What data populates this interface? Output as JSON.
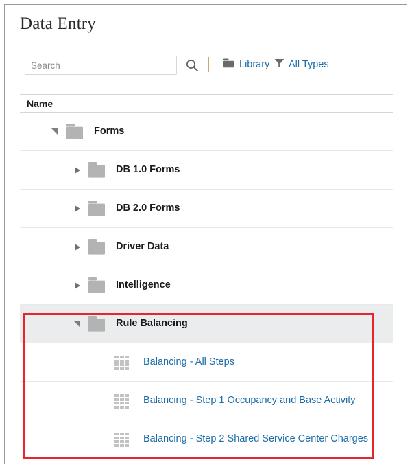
{
  "page": {
    "title": "Data Entry"
  },
  "toolbar": {
    "search_placeholder": "Search",
    "search_value": "",
    "search_icon": "search-icon",
    "library_label": "Library",
    "library_icon": "folder-icon",
    "all_types_label": "All Types",
    "all_types_icon": "filter-funnel-icon"
  },
  "table": {
    "columns": [
      "Name"
    ],
    "rows": [
      {
        "label": "Forms",
        "type": "folder",
        "icon": "folder-icon",
        "state": "expanded",
        "level": 0,
        "selected": false,
        "is_link": false
      },
      {
        "label": "DB 1.0 Forms",
        "type": "folder",
        "icon": "folder-icon",
        "state": "collapsed",
        "level": 1,
        "selected": false,
        "is_link": false
      },
      {
        "label": "DB 2.0 Forms",
        "type": "folder",
        "icon": "folder-icon",
        "state": "collapsed",
        "level": 1,
        "selected": false,
        "is_link": false
      },
      {
        "label": "Driver Data",
        "type": "folder",
        "icon": "folder-icon",
        "state": "collapsed",
        "level": 1,
        "selected": false,
        "is_link": false
      },
      {
        "label": "Intelligence",
        "type": "folder",
        "icon": "folder-icon",
        "state": "collapsed",
        "level": 1,
        "selected": false,
        "is_link": false
      },
      {
        "label": "Rule Balancing",
        "type": "folder",
        "icon": "folder-icon",
        "state": "expanded",
        "level": 1,
        "selected": true,
        "is_link": false
      },
      {
        "label": "Balancing - All Steps",
        "type": "form",
        "icon": "form-grid-icon",
        "state": "none",
        "level": 2,
        "selected": false,
        "is_link": true
      },
      {
        "label": "Balancing - Step 1 Occupancy and Base Activity",
        "type": "form",
        "icon": "form-grid-icon",
        "state": "none",
        "level": 2,
        "selected": false,
        "is_link": true
      },
      {
        "label": "Balancing - Step 2 Shared Service Center Charges",
        "type": "form",
        "icon": "form-grid-icon",
        "state": "none",
        "level": 2,
        "selected": false,
        "is_link": true
      }
    ]
  },
  "annotation": {
    "highlight_color": "#e8252a",
    "shape": "rectangle"
  },
  "colors": {
    "link": "#1b6ca8",
    "folder": "#b3b3b3",
    "folder_dark": "#6b6b6b",
    "selected_row": "#eaecee",
    "text": "#1a1a1a",
    "border": "#e6e8ea"
  }
}
